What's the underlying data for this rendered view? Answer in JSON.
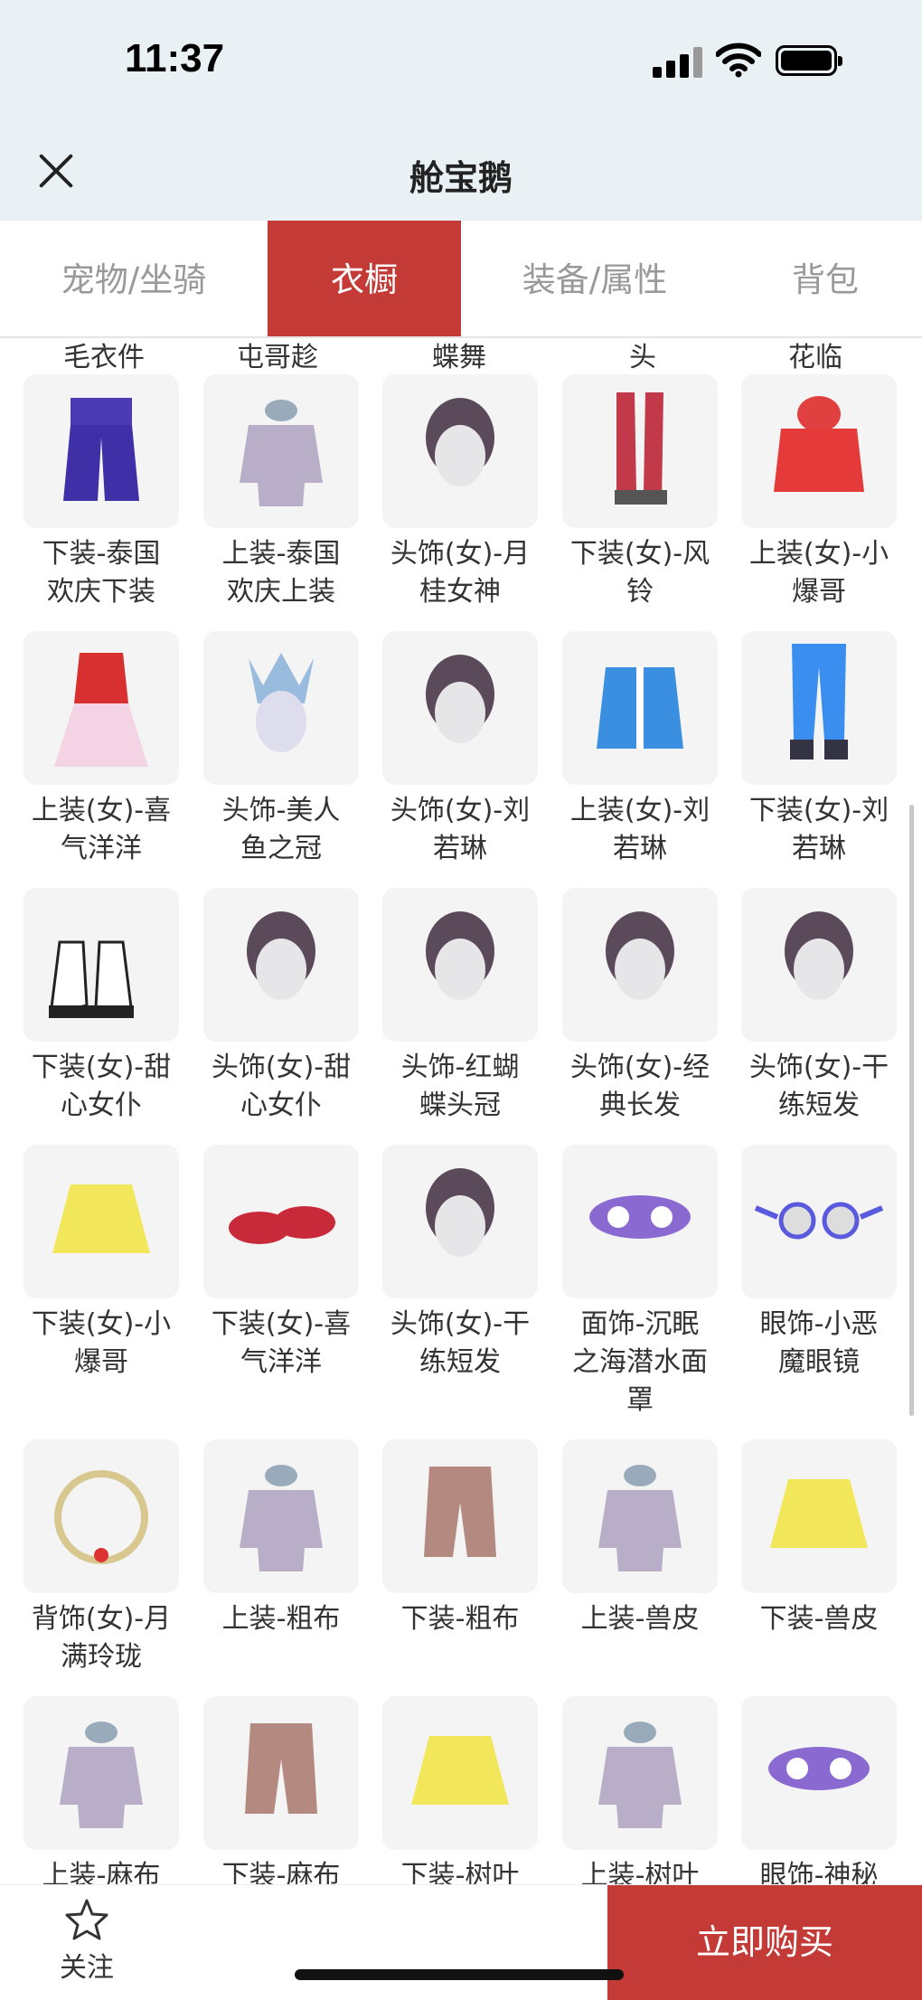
{
  "status_bar": {
    "time": "11:37"
  },
  "header": {
    "title": "舱宝鹅"
  },
  "tabs": [
    "宠物/坐骑",
    "衣橱",
    "装备/属性",
    "背包"
  ],
  "active_tab": 1,
  "peek_labels": [
    "毛衣件",
    "屯哥趁",
    "蝶舞",
    "头",
    "花临"
  ],
  "items": [
    {
      "name": "下装-泰国欢庆下装",
      "label1": "下装-泰国",
      "label2": "欢庆下装",
      "label3": "",
      "icon": "pants-icon"
    },
    {
      "name": "上装-泰国欢庆上装",
      "label1": "上装-泰国",
      "label2": "欢庆上装",
      "label3": "",
      "icon": "top-icon"
    },
    {
      "name": "头饰(女)-月桂女神",
      "label1": "头饰(女)-月",
      "label2": "桂女神",
      "label3": "",
      "icon": "head-icon"
    },
    {
      "name": "下装(女)-风铃",
      "label1": "下装(女)-风",
      "label2": "铃",
      "label3": "",
      "icon": "boots-icon"
    },
    {
      "name": "上装(女)-小爆哥",
      "label1": "上装(女)-小",
      "label2": "爆哥",
      "label3": "",
      "icon": "hoodie-icon"
    },
    {
      "name": "上装(女)-喜气洋洋",
      "label1": "上装(女)-喜",
      "label2": "气洋洋",
      "label3": "",
      "icon": "dress-icon"
    },
    {
      "name": "头饰-美人鱼之冠",
      "label1": "头饰-美人",
      "label2": "鱼之冠",
      "label3": "",
      "icon": "crown-head-icon"
    },
    {
      "name": "头饰(女)-刘若琳",
      "label1": "头饰(女)-刘",
      "label2": "若琳",
      "label3": "",
      "icon": "head-icon"
    },
    {
      "name": "上装(女)-刘若琳",
      "label1": "上装(女)-刘",
      "label2": "若琳",
      "label3": "",
      "icon": "jacket-icon"
    },
    {
      "name": "下装(女)-刘若琳",
      "label1": "下装(女)-刘",
      "label2": "若琳",
      "label3": "",
      "icon": "jeans-icon"
    },
    {
      "name": "下装(女)-甜心女仆",
      "label1": "下装(女)-甜",
      "label2": "心女仆",
      "label3": "",
      "icon": "shoes-icon"
    },
    {
      "name": "头饰(女)-甜心女仆",
      "label1": "头饰(女)-甜",
      "label2": "心女仆",
      "label3": "",
      "icon": "head-icon"
    },
    {
      "name": "头饰-红蝴蝶头冠",
      "label1": "头饰-红蝴",
      "label2": "蝶头冠",
      "label3": "",
      "icon": "head-icon"
    },
    {
      "name": "头饰(女)-经典长发",
      "label1": "头饰(女)-经",
      "label2": "典长发",
      "label3": "",
      "icon": "head-icon"
    },
    {
      "name": "头饰(女)-干练短发",
      "label1": "头饰(女)-干",
      "label2": "练短发",
      "label3": "",
      "icon": "head-icon"
    },
    {
      "name": "下装(女)-小爆哥",
      "label1": "下装(女)-小",
      "label2": "爆哥",
      "label3": "",
      "icon": "skirt-icon"
    },
    {
      "name": "下装(女)-喜气洋洋",
      "label1": "下装(女)-喜",
      "label2": "气洋洋",
      "label3": "",
      "icon": "slippers-icon"
    },
    {
      "name": "头饰(女)-干练短发",
      "label1": "头饰(女)-干",
      "label2": "练短发",
      "label3": "",
      "icon": "head-icon"
    },
    {
      "name": "面饰-沉眠之海潜水面罩",
      "label1": "面饰-沉眠",
      "label2": "之海潜水面",
      "label3": "罩",
      "icon": "mask-icon"
    },
    {
      "name": "眼饰-小恶魔眼镜",
      "label1": "眼饰-小恶",
      "label2": "魔眼镜",
      "label3": "",
      "icon": "glasses-icon"
    },
    {
      "name": "背饰(女)-月满玲珑",
      "label1": "背饰(女)-月",
      "label2": "满玲珑",
      "label3": "",
      "icon": "ring-icon"
    },
    {
      "name": "上装-粗布",
      "label1": "上装-粗布",
      "label2": "",
      "label3": "",
      "icon": "top-icon"
    },
    {
      "name": "下装-粗布",
      "label1": "下装-粗布",
      "label2": "",
      "label3": "",
      "icon": "shorts-icon"
    },
    {
      "name": "上装-兽皮",
      "label1": "上装-兽皮",
      "label2": "",
      "label3": "",
      "icon": "top-icon"
    },
    {
      "name": "下装-兽皮",
      "label1": "下装-兽皮",
      "label2": "",
      "label3": "",
      "icon": "skirt-icon"
    },
    {
      "name": "上装-麻布",
      "label1": "上装-麻布",
      "label2": "",
      "label3": "",
      "icon": "top-icon"
    },
    {
      "name": "下装-麻布",
      "label1": "下装-麻布",
      "label2": "",
      "label3": "",
      "icon": "shorts-icon"
    },
    {
      "name": "下装-树叶",
      "label1": "下装-树叶",
      "label2": "",
      "label3": "",
      "icon": "skirt-icon"
    },
    {
      "name": "上装-树叶",
      "label1": "上装-树叶",
      "label2": "",
      "label3": "",
      "icon": "top-icon"
    },
    {
      "name": "眼饰-神秘",
      "label1": "眼饰-神秘",
      "label2": "",
      "label3": "",
      "icon": "mask-icon"
    }
  ],
  "bottom": {
    "fav_label": "关注",
    "buy_label": "立即购买"
  },
  "colors": {
    "accent": "#c43a36",
    "header_bg": "#eaf1f5",
    "thumb_bg": "#f4f4f4"
  }
}
